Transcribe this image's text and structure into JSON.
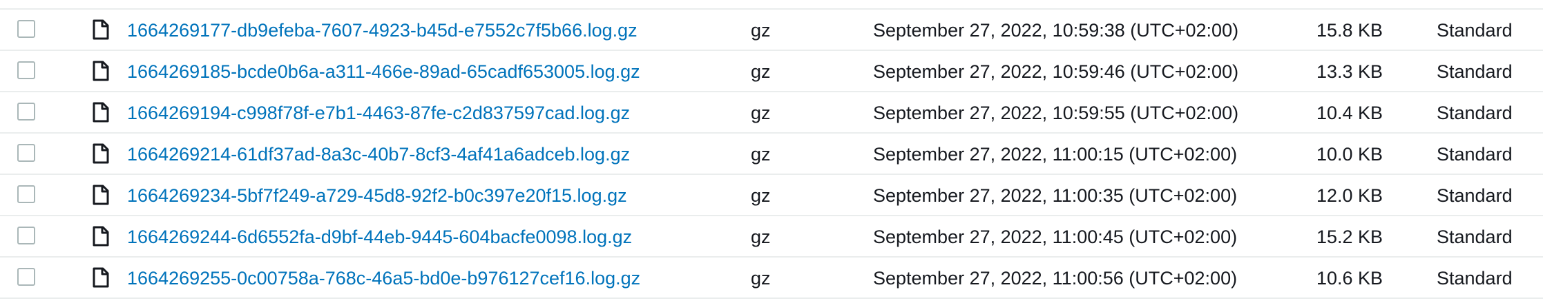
{
  "icons": {
    "checkbox": "checkbox-unchecked",
    "file": "file-icon"
  },
  "colors": {
    "link": "#0073bb",
    "text": "#16191f",
    "divider": "#eaeded",
    "checkbox_border": "#aab7b8"
  },
  "rows": [
    {
      "name": "1664269177-db9efeba-7607-4923-b45d-e7552c7f5b66.log.gz",
      "type": "gz",
      "last_modified": "September 27, 2022, 10:59:38 (UTC+02:00)",
      "size": "15.8 KB",
      "storage_class": "Standard"
    },
    {
      "name": "1664269185-bcde0b6a-a311-466e-89ad-65cadf653005.log.gz",
      "type": "gz",
      "last_modified": "September 27, 2022, 10:59:46 (UTC+02:00)",
      "size": "13.3 KB",
      "storage_class": "Standard"
    },
    {
      "name": "1664269194-c998f78f-e7b1-4463-87fe-c2d837597cad.log.gz",
      "type": "gz",
      "last_modified": "September 27, 2022, 10:59:55 (UTC+02:00)",
      "size": "10.4 KB",
      "storage_class": "Standard"
    },
    {
      "name": "1664269214-61df37ad-8a3c-40b7-8cf3-4af41a6adceb.log.gz",
      "type": "gz",
      "last_modified": "September 27, 2022, 11:00:15 (UTC+02:00)",
      "size": "10.0 KB",
      "storage_class": "Standard"
    },
    {
      "name": "1664269234-5bf7f249-a729-45d8-92f2-b0c397e20f15.log.gz",
      "type": "gz",
      "last_modified": "September 27, 2022, 11:00:35 (UTC+02:00)",
      "size": "12.0 KB",
      "storage_class": "Standard"
    },
    {
      "name": "1664269244-6d6552fa-d9bf-44eb-9445-604bacfe0098.log.gz",
      "type": "gz",
      "last_modified": "September 27, 2022, 11:00:45 (UTC+02:00)",
      "size": "15.2 KB",
      "storage_class": "Standard"
    },
    {
      "name": "1664269255-0c00758a-768c-46a5-bd0e-b976127cef16.log.gz",
      "type": "gz",
      "last_modified": "September 27, 2022, 11:00:56 (UTC+02:00)",
      "size": "10.6 KB",
      "storage_class": "Standard"
    }
  ]
}
